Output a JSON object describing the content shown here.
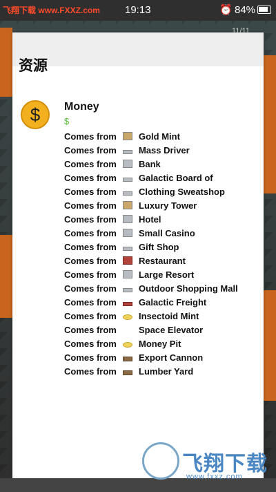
{
  "status_bar": {
    "watermark": "飞翔下载",
    "watermark_url": "www.FXXZ.com",
    "time": "19:13",
    "battery": "84%"
  },
  "game": {
    "level_counter": "11/11"
  },
  "dialog": {
    "title": "资源",
    "resource": {
      "name": "Money",
      "symbol": "$",
      "coin_glyph": "$",
      "coin_color": "#f2b01e",
      "symbol_color": "#5cbf3c"
    },
    "sources_prefix": "Comes from",
    "sources": [
      {
        "label": "Gold Mint",
        "icon": "gold-mint-icon"
      },
      {
        "label": "Mass Driver",
        "icon": "mass-driver-icon"
      },
      {
        "label": "Bank",
        "icon": "bank-icon"
      },
      {
        "label": "Galactic Board of",
        "icon": "galactic-board-icon"
      },
      {
        "label": "Clothing Sweatshop",
        "icon": "clothing-sweatshop-icon"
      },
      {
        "label": "Luxury Tower",
        "icon": "luxury-tower-icon"
      },
      {
        "label": "Hotel",
        "icon": "hotel-icon"
      },
      {
        "label": "Small Casino",
        "icon": "small-casino-icon"
      },
      {
        "label": "Gift Shop",
        "icon": "gift-shop-icon"
      },
      {
        "label": "Restaurant",
        "icon": "restaurant-icon"
      },
      {
        "label": "Large Resort",
        "icon": "large-resort-icon"
      },
      {
        "label": "Outdoor Shopping Mall",
        "icon": "outdoor-shopping-mall-icon"
      },
      {
        "label": "Galactic Freight",
        "icon": "galactic-freight-icon"
      },
      {
        "label": "Insectoid Mint",
        "icon": "insectoid-mint-icon"
      },
      {
        "label": "Space Elevator",
        "icon": "space-elevator-icon"
      },
      {
        "label": "Money Pit",
        "icon": "money-pit-icon"
      },
      {
        "label": "Export Cannon",
        "icon": "export-cannon-icon"
      },
      {
        "label": "Lumber Yard",
        "icon": "lumber-yard-icon"
      }
    ]
  },
  "corner_logo": {
    "brand": "飞翔下载",
    "site": "www.fxxz.com"
  }
}
